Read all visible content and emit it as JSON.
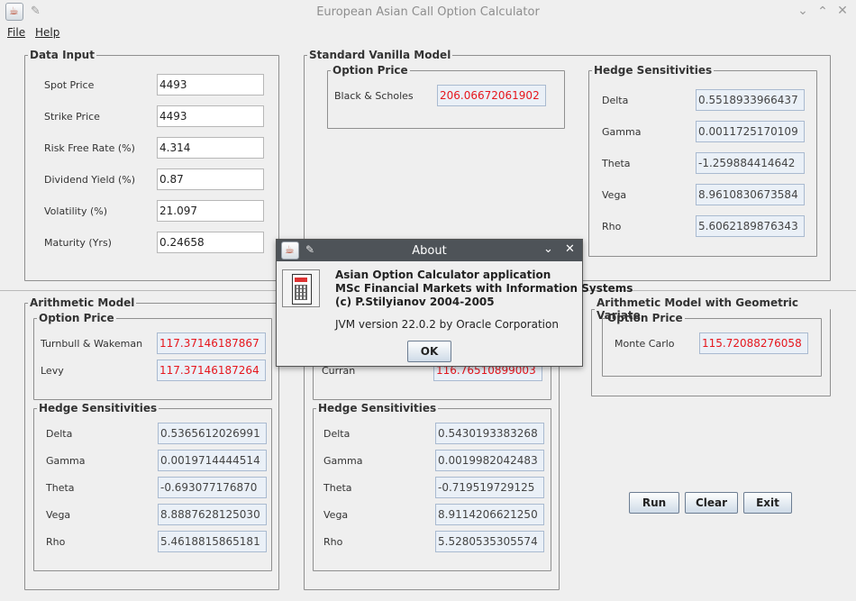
{
  "window": {
    "title": "European Asian Call Option Calculator"
  },
  "menu": {
    "file": "File",
    "help": "Help"
  },
  "data_input": {
    "title": "Data Input",
    "fields": [
      {
        "label": "Spot Price",
        "value": "4493"
      },
      {
        "label": "Strike Price",
        "value": "4493"
      },
      {
        "label": "Risk Free Rate (%)",
        "value": "4.314"
      },
      {
        "label": "Dividend Yield (%)",
        "value": "0.87"
      },
      {
        "label": "Volatility (%)",
        "value": "21.097"
      },
      {
        "label": "Maturity (Yrs)",
        "value": "0.24658"
      }
    ]
  },
  "vanilla": {
    "title": "Standard Vanilla Model",
    "option_price": {
      "title": "Option Price",
      "label": "Black & Scholes",
      "value": "206.06672061902"
    },
    "hedge": {
      "title": "Hedge Sensitivities",
      "rows": [
        {
          "label": "Delta",
          "value": "0.5518933966437"
        },
        {
          "label": "Gamma",
          "value": "0.0011725170109"
        },
        {
          "label": "Theta",
          "value": "-1.259884414642"
        },
        {
          "label": "Vega",
          "value": "8.9610830673584"
        },
        {
          "label": "Rho",
          "value": "5.6062189876343"
        }
      ]
    }
  },
  "arithmetic": {
    "title": "Arithmetic Model",
    "option_price": {
      "title": "Option Price",
      "rows": [
        {
          "label": "Turnbull & Wakeman",
          "value": "117.37146187867"
        },
        {
          "label": "Levy",
          "value": "117.37146187264"
        }
      ]
    },
    "hedge": {
      "title": "Hedge Sensitivities",
      "rows": [
        {
          "label": "Delta",
          "value": "0.5365612026991"
        },
        {
          "label": "Gamma",
          "value": "0.0019714444514"
        },
        {
          "label": "Theta",
          "value": "-0.693077176870"
        },
        {
          "label": "Vega",
          "value": "8.8887628125030"
        },
        {
          "label": "Rho",
          "value": "5.4618815865181"
        }
      ]
    }
  },
  "geometric": {
    "option_price": {
      "label": "Curran",
      "value": "116.76510899003"
    },
    "hedge": {
      "title": "Hedge Sensitivities",
      "rows": [
        {
          "label": "Delta",
          "value": "0.5430193383268"
        },
        {
          "label": "Gamma",
          "value": "0.0019982042483"
        },
        {
          "label": "Theta",
          "value": "-0.719519729125"
        },
        {
          "label": "Vega",
          "value": "8.9114206621250"
        },
        {
          "label": "Rho",
          "value": "5.5280535305574"
        }
      ]
    }
  },
  "control_variate": {
    "title": "Arithmetic Model with Geometric Variate",
    "option_price": {
      "title": "Option Price",
      "label": "Monte Carlo",
      "value": "115.72088276058"
    }
  },
  "buttons": {
    "run": "Run",
    "clear": "Clear",
    "exit": "Exit"
  },
  "about": {
    "title": "About",
    "line1": "Asian Option Calculator application",
    "line2": "MSc Financial Markets with Information Systems",
    "line3": "(c) P.Stilyianov 2004-2005",
    "jvm": "JVM version 22.0.2 by Oracle Corporation",
    "ok": "OK"
  },
  "icons": {
    "app": "java-cup-icon",
    "pin": "pin-icon",
    "minimize": "chevron-down-icon",
    "maximize": "chevron-up-icon",
    "close": "close-icon",
    "about_image": "calculator-icon"
  }
}
